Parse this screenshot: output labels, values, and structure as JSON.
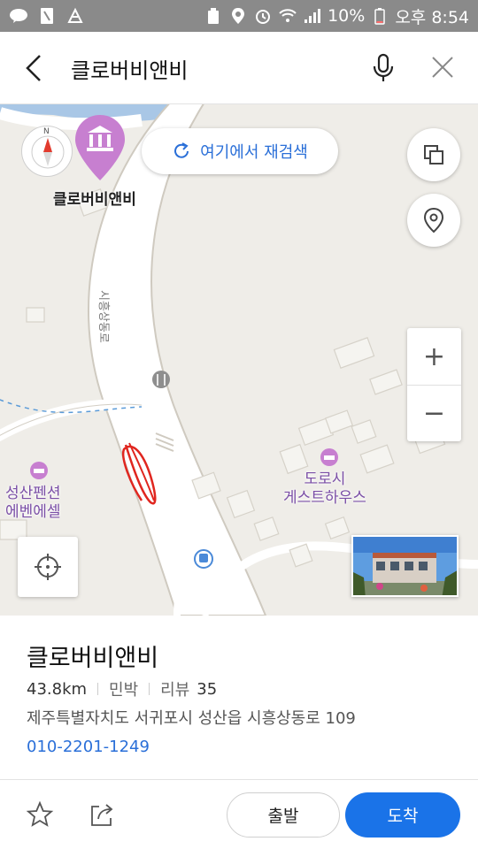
{
  "status_bar": {
    "battery": "10%",
    "time": "오후 8:54"
  },
  "search": {
    "query": "클로버비앤비"
  },
  "map": {
    "pin_label": "클로버비앤비",
    "research_label": "여기에서 재검색",
    "road_name": "시흥상동로",
    "pois": [
      {
        "name_line1": "성산펜션",
        "name_line2": "에벤에셀"
      },
      {
        "name_line1": "도로시",
        "name_line2": "게스트하우스"
      }
    ],
    "compass_north": "N",
    "zoom_in": "+",
    "zoom_out": "−"
  },
  "place": {
    "name": "클로버비앤비",
    "distance": "43.8km",
    "category": "민박",
    "review_label": "리뷰",
    "review_count": "35",
    "address": "제주특별자치도 서귀포시 성산읍 시흥상동로 109",
    "phone": "010-2201-1249"
  },
  "actions": {
    "start_label": "출발",
    "arrive_label": "도착"
  },
  "colors": {
    "accent": "#1a73e8",
    "pin": "#c77fd0",
    "poi_text": "#7a4ea6"
  }
}
